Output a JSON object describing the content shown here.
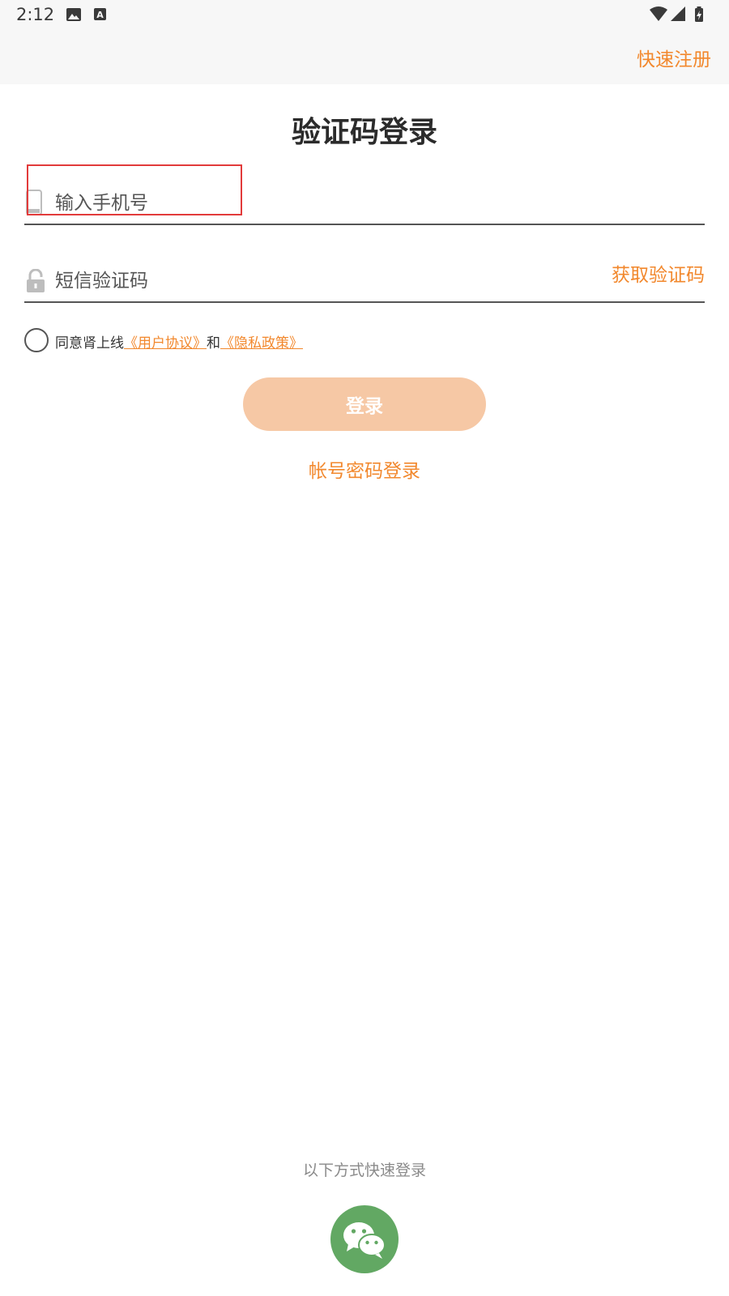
{
  "status_bar": {
    "time": "2:12",
    "icons": [
      "image-icon",
      "a-letter-icon",
      "wifi-icon",
      "signal-icon",
      "battery-charging-icon"
    ]
  },
  "header": {
    "register_label": "快速注册"
  },
  "title": "验证码登录",
  "phone_field": {
    "placeholder": "输入手机号",
    "icon": "phone-icon"
  },
  "code_field": {
    "placeholder": "短信验证码",
    "icon": "lock-icon",
    "get_code_label": "获取验证码"
  },
  "agreement": {
    "prefix": "同意肾上线",
    "user_agreement": "《用户协议》",
    "conjunction": "和",
    "privacy_policy": "《隐私政策》"
  },
  "login_button_label": "登录",
  "password_login_label": "帐号密码登录",
  "quick_login": {
    "label": "以下方式快速登录",
    "icon": "wechat-icon"
  },
  "colors": {
    "accent": "#f2882d",
    "login_button_disabled": "#f6c8a5",
    "wechat_green": "#62a863",
    "highlight_red": "#e23b3b"
  }
}
